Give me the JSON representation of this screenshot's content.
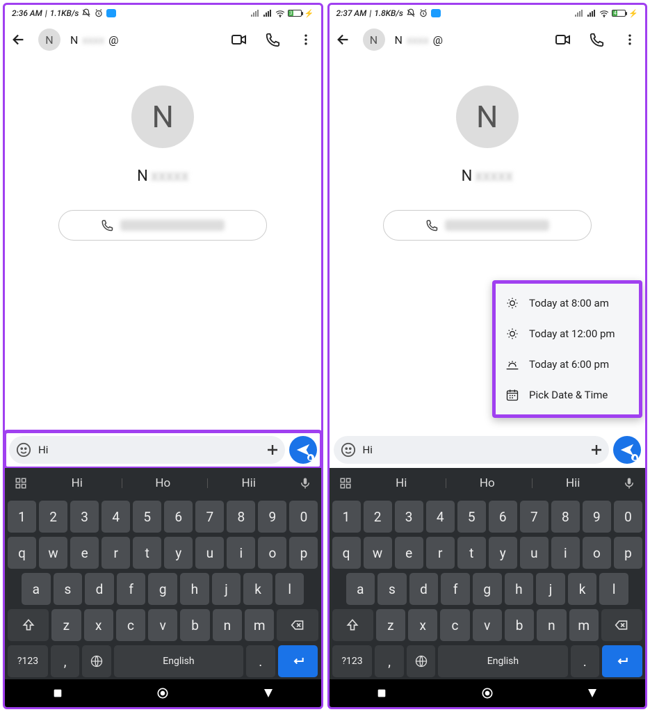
{
  "screens": [
    {
      "statusbar": {
        "time": "2:36 AM",
        "net": "1.1KB/s",
        "battery_label": "3"
      },
      "header": {
        "avatar_initial": "N",
        "name_prefix": "N",
        "at": "@"
      },
      "contact": {
        "avatar_initial": "N",
        "name_prefix": "N"
      },
      "input": {
        "value": "Hi",
        "highlighted": true
      },
      "schedule_visible": false
    },
    {
      "statusbar": {
        "time": "2:37 AM",
        "net": "1.8KB/s",
        "battery_label": "4"
      },
      "header": {
        "avatar_initial": "N",
        "name_prefix": "N",
        "at": "@"
      },
      "contact": {
        "avatar_initial": "N",
        "name_prefix": "N"
      },
      "input": {
        "value": "Hi",
        "highlighted": false
      },
      "schedule_visible": true
    }
  ],
  "schedule_menu": [
    {
      "icon": "sun-partial",
      "label": "Today at 8:00 am"
    },
    {
      "icon": "sun-full",
      "label": "Today at 12:00 pm"
    },
    {
      "icon": "sunset",
      "label": "Today at 6:00 pm"
    },
    {
      "icon": "calendar",
      "label": "Pick Date & Time"
    }
  ],
  "keyboard": {
    "suggestions": [
      "Hi",
      "Ho",
      "Hii"
    ],
    "row_num": [
      "1",
      "2",
      "3",
      "4",
      "5",
      "6",
      "7",
      "8",
      "9",
      "0"
    ],
    "row_top": [
      "q",
      "w",
      "e",
      "r",
      "t",
      "y",
      "u",
      "i",
      "o",
      "p"
    ],
    "row_mid": [
      "a",
      "s",
      "d",
      "f",
      "g",
      "h",
      "j",
      "k",
      "l"
    ],
    "row_bot": [
      "z",
      "x",
      "c",
      "v",
      "b",
      "n",
      "m"
    ],
    "sym_key": "?123",
    "comma": ",",
    "period": ".",
    "space_label": "English"
  }
}
